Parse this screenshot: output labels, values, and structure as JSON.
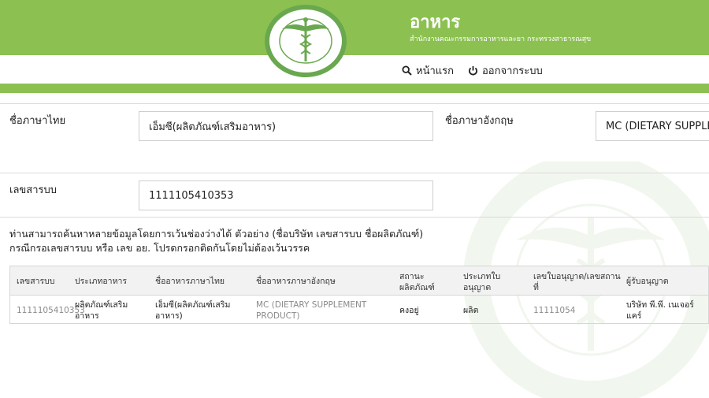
{
  "header": {
    "title": "อาหาร",
    "subtitle": "สำนักงานคณะกรรมการอาหารและยา กระทรวงสาธารณสุข",
    "colors": {
      "brand_green": "#8cc152",
      "seal_green": "#6aa84f"
    }
  },
  "nav": {
    "home": {
      "label": "หน้าแรก",
      "icon": "search-icon"
    },
    "logout": {
      "label": "ออกจากระบบ",
      "icon": "power-icon"
    }
  },
  "form": {
    "thai_name": {
      "label": "ชื่อภาษาไทย",
      "value": "เอ็มซี(ผลิตภัณฑ์เสริมอาหาร)"
    },
    "english_name": {
      "label": "ชื่อภาษาอังกฤษ",
      "value": "MC (DIETARY SUPPLE"
    },
    "reg_number": {
      "label": "เลขสารบบ",
      "value": "1111105410353"
    }
  },
  "note": {
    "line1": "ท่านสามารถค้นหาหลายข้อมูลโดยการเว้นช่องว่างได้ ตัวอย่าง (ชื่อบริษัท เลขสารบบ ชื่อผลิตภัณฑ์)",
    "line2": "กรณีกรอเลขสารบบ หรือ เลข อย. โปรดกรอกติดกันโดยไม่ต้องเว้นวรรค"
  },
  "table": {
    "headers": {
      "reg": "เลขสารบบ",
      "type": "ประเภทอาหาร",
      "thai": "ชื่ออาหารภาษาไทย",
      "eng": "ชื่ออาหารภาษาอังกฤษ",
      "status": "สถานะผลิตภัณฑ์",
      "license_type": "ประเภทใบอนุญาต",
      "license_no": "เลขใบอนุญาต/เลขสถานที่",
      "licensee": "ผู้รับอนุญาต"
    },
    "row": {
      "reg": "1111105410353",
      "type": "ผลิตภัณฑ์เสริมอาหาร",
      "thai": "เอ็มซี(ผลิตภัณฑ์เสริมอาหาร)",
      "eng": "MC (DIETARY SUPPLEMENT PRODUCT)",
      "status": "คงอยู่",
      "license_type": "ผลิต",
      "license_no": "11111054",
      "licensee": "บริษัท พี.พี. เนเจอร์ แคร์"
    }
  }
}
